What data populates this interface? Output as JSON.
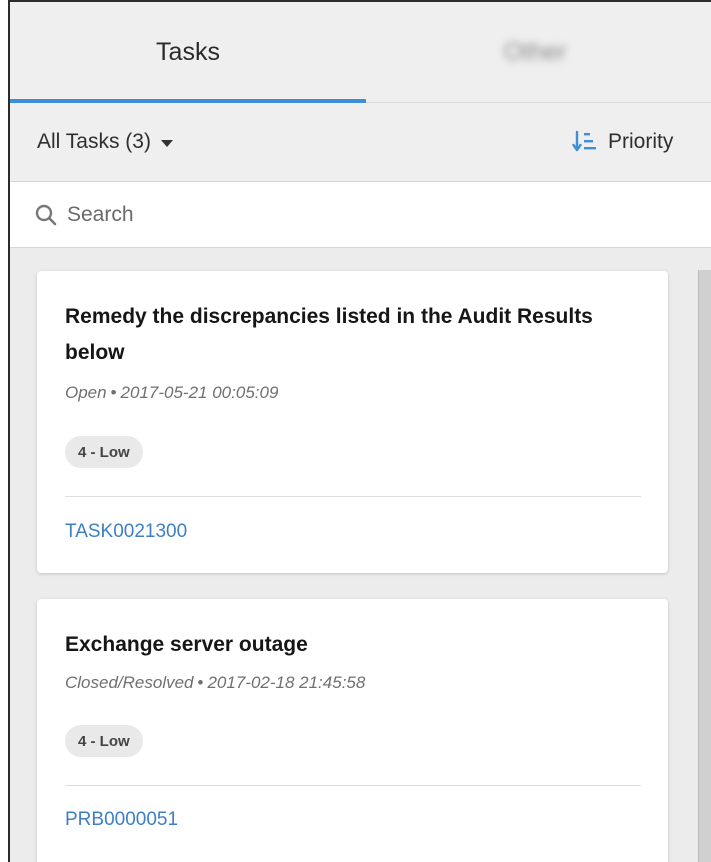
{
  "tabs": [
    {
      "label": "Tasks",
      "active": true
    },
    {
      "label": "Other",
      "active": false
    }
  ],
  "filter": {
    "label": "All Tasks (3)"
  },
  "sort": {
    "label": "Priority",
    "icon": "sort-icon"
  },
  "search": {
    "placeholder": "Search",
    "value": ""
  },
  "colors": {
    "accent": "#3d8fd6",
    "link": "#3e7fc4"
  },
  "cards": [
    {
      "title": "Remedy the discrepancies listed in the Audit Results below",
      "status": "Open",
      "timestamp": "2017-05-21 00:05:09",
      "priority": "4 - Low",
      "number": "TASK0021300"
    },
    {
      "title": "Exchange server outage",
      "status": "Closed/Resolved",
      "timestamp": "2017-02-18 21:45:58",
      "priority": "4 - Low",
      "number": "PRB0000051"
    }
  ]
}
